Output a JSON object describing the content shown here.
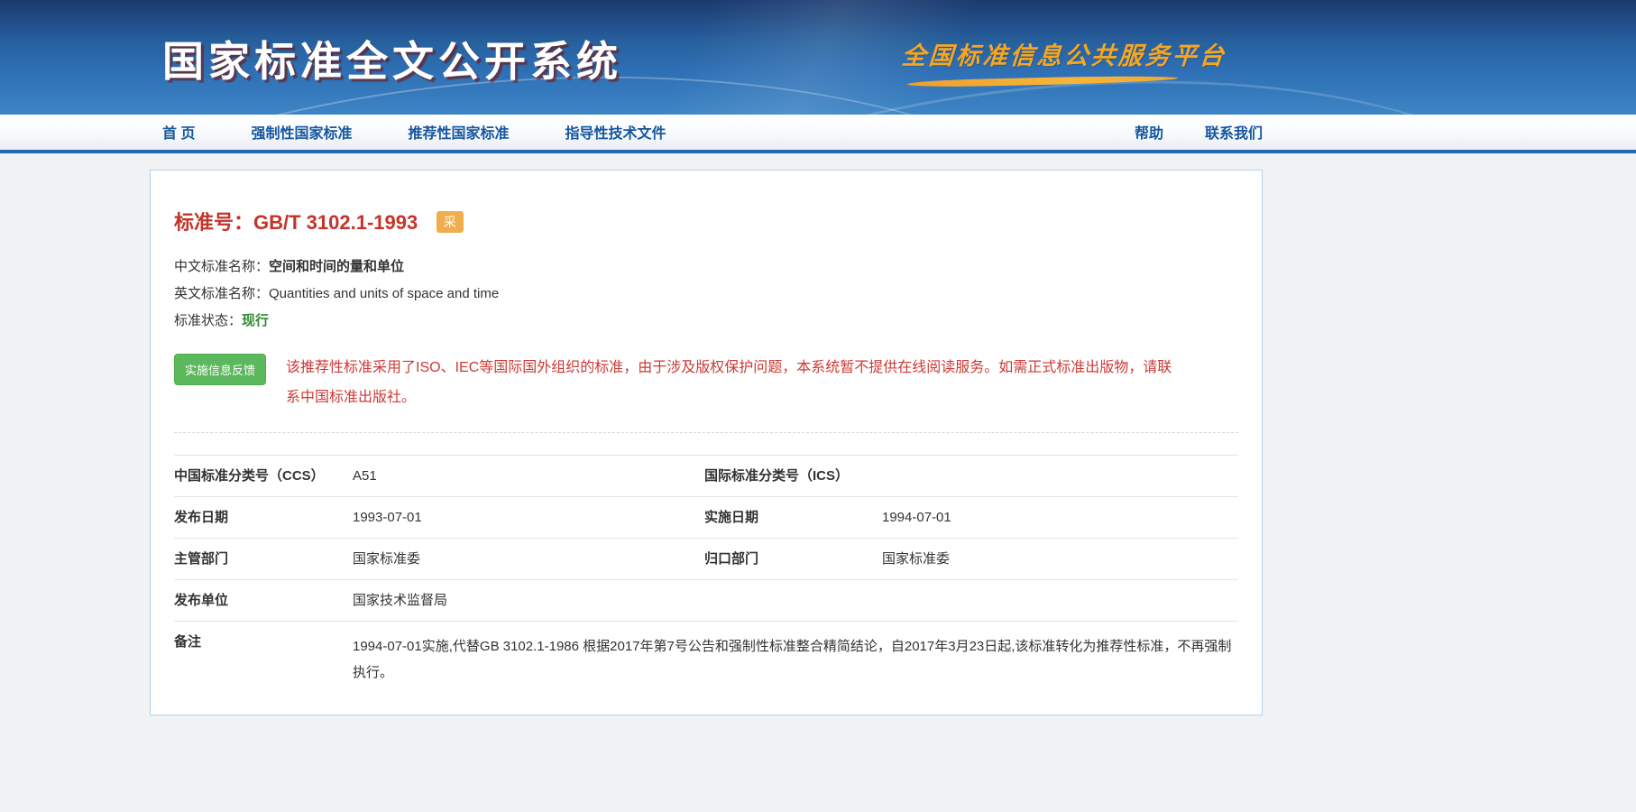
{
  "header": {
    "title": "国家标准全文公开系统",
    "platform_name": "全国标准信息公共服务平台"
  },
  "nav": {
    "items": [
      {
        "label": "首 页"
      },
      {
        "label": "强制性国家标准"
      },
      {
        "label": "推荐性国家标准"
      },
      {
        "label": "指导性技术文件"
      }
    ],
    "right_items": [
      {
        "label": "帮助"
      },
      {
        "label": "联系我们"
      }
    ]
  },
  "detail": {
    "standard_no_label": "标准号：",
    "standard_no": "GB/T 3102.1-1993",
    "adopted_badge": "采",
    "cn_name_label": "中文标准名称：",
    "cn_name": "空间和时间的量和单位",
    "en_name_label": "英文标准名称：",
    "en_name": "Quantities and units of space and time",
    "status_label": "标准状态：",
    "status": "现行",
    "feedback_button": "实施信息反馈",
    "copyright_notice": "该推荐性标准采用了ISO、IEC等国际国外组织的标准，由于涉及版权保护问题，本系统暂不提供在线阅读服务。如需正式标准出版物，请联系中国标准出版社。",
    "table": {
      "rows": [
        {
          "cells": [
            {
              "label": "中国标准分类号（CCS）",
              "value": "A51"
            },
            {
              "label": "国际标准分类号（ICS）",
              "value": ""
            }
          ]
        },
        {
          "cells": [
            {
              "label": "发布日期",
              "value": "1993-07-01"
            },
            {
              "label": "实施日期",
              "value": "1994-07-01"
            }
          ]
        },
        {
          "cells": [
            {
              "label": "主管部门",
              "value": "国家标准委"
            },
            {
              "label": "归口部门",
              "value": "国家标准委"
            }
          ]
        },
        {
          "cells": [
            {
              "label": "发布单位",
              "value": "国家技术监督局"
            }
          ]
        },
        {
          "cells": [
            {
              "label": "备注",
              "value": "1994-07-01实施,代替GB 3102.1-1986 根据2017年第7号公告和强制性标准整合精简结论，自2017年3月23日起,该标准转化为推荐性标准，不再强制执行。"
            }
          ]
        }
      ]
    }
  },
  "colors": {
    "accent_red": "#c4342b",
    "notice_red": "#cc3a36",
    "badge_orange": "#f0ad4e",
    "button_green": "#5cb85c",
    "status_green": "#2e8b2e",
    "nav_blue": "#1456a0",
    "platform_orange": "#f5a623"
  }
}
